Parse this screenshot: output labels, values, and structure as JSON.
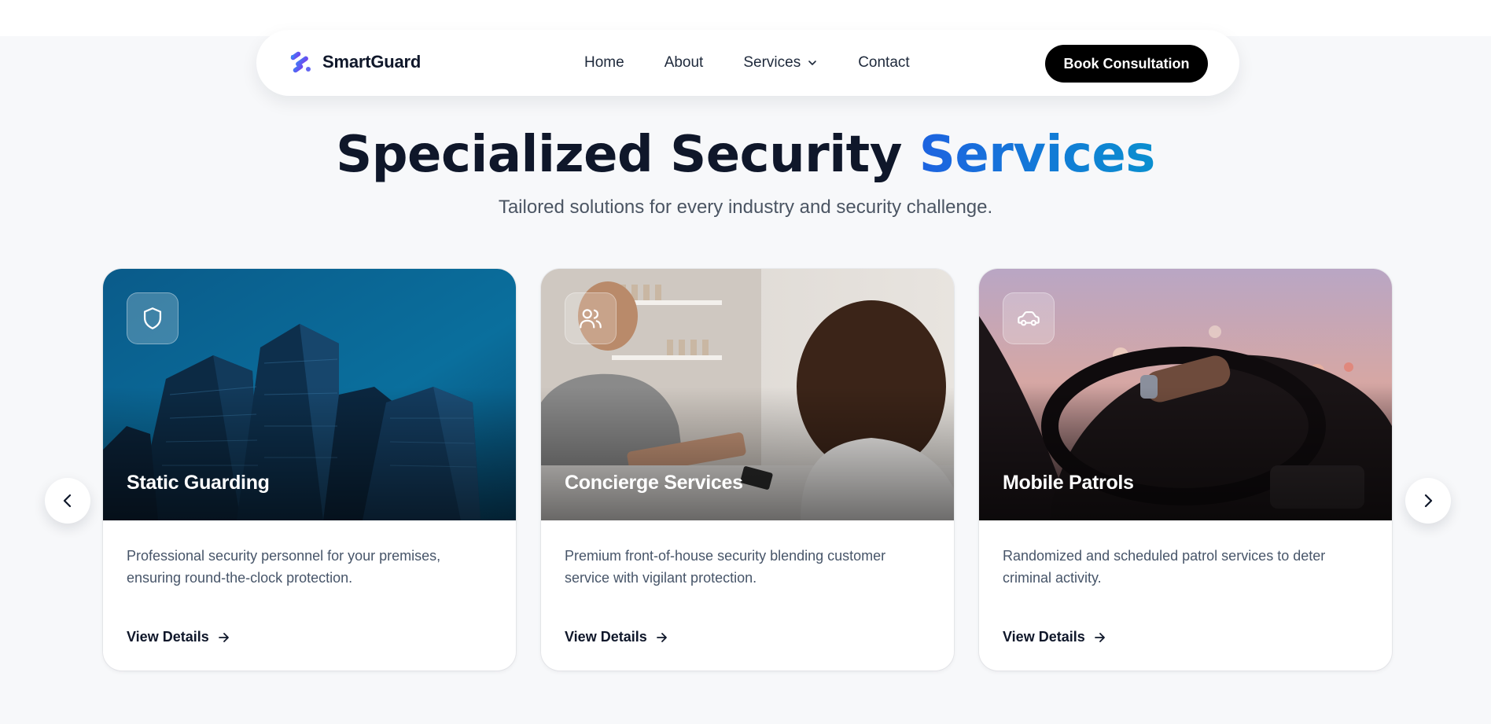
{
  "brand": {
    "name": "SmartGuard",
    "logo_icon": "stacked-dashes-logo-icon"
  },
  "nav": {
    "items": [
      {
        "label": "Home"
      },
      {
        "label": "About"
      },
      {
        "label": "Services",
        "has_dropdown": true
      },
      {
        "label": "Contact"
      }
    ],
    "cta_label": "Book Consultation"
  },
  "hero": {
    "title_main": "Specialized Security ",
    "title_accent": "Services",
    "subtitle": "Tailored solutions for every industry and security challenge."
  },
  "cards": [
    {
      "icon": "shield-icon",
      "title": "Static Guarding",
      "description": "Professional security personnel for your premises, ensuring round-the-clock protection.",
      "link_label": "View Details"
    },
    {
      "icon": "users-icon",
      "title": "Concierge Services",
      "description": "Premium front-of-house security blending customer service with vigilant protection.",
      "link_label": "View Details"
    },
    {
      "icon": "car-icon",
      "title": "Mobile Patrols",
      "description": "Randomized and scheduled patrol services to deter criminal activity.",
      "link_label": "View Details"
    }
  ],
  "carousel": {
    "prev_icon": "chevron-left-icon",
    "next_icon": "chevron-right-icon"
  },
  "colors": {
    "accent_start": "#1d63e0",
    "accent_end": "#0a8fcf",
    "cta_background": "#000000",
    "page_background": "#f7f8fa"
  }
}
